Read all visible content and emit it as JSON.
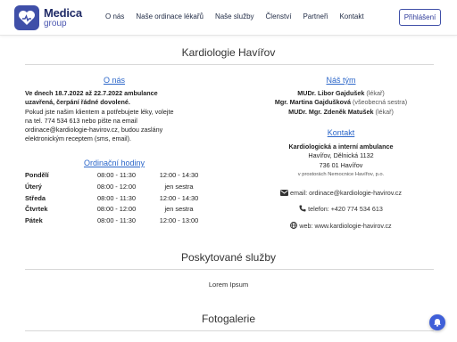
{
  "brand": {
    "name": "Medica",
    "sub": "group"
  },
  "nav": {
    "items": [
      {
        "label": "O nás"
      },
      {
        "label": "Naše ordinace lékařů"
      },
      {
        "label": "Naše služby"
      },
      {
        "label": "Členství"
      },
      {
        "label": "Partneři"
      },
      {
        "label": "Kontakt"
      }
    ],
    "login_label": "Přihlášení"
  },
  "page_title": "Kardiologie Havířov",
  "about": {
    "heading": "O nás",
    "notice_bold_1": "Ve dnech 18.7.2022 až 22.7.2022 ambulance",
    "notice_bold_2": "uzavřená, čerpání řádné dovolené.",
    "lines": [
      "Pokud jste našim klientem a potřebujete léky, volejte",
      "na tel. 774 534 613 nebo pište na email",
      "ordinace@kardiologie-havirov.cz, budou zaslány",
      "elektronickým receptem (sms, email)."
    ]
  },
  "hours": {
    "heading": "Ordinační hodiny",
    "rows": [
      {
        "day": "Pondělí",
        "a": "08:00 - 11:30",
        "b": "12:00 - 14:30"
      },
      {
        "day": "Úterý",
        "a": "08:00 - 12:00",
        "b": "jen sestra"
      },
      {
        "day": "Středa",
        "a": "08:00 - 11:30",
        "b": "12:00 - 14:30"
      },
      {
        "day": "Čtvrtek",
        "a": "08:00 - 12:00",
        "b": "jen sestra"
      },
      {
        "day": "Pátek",
        "a": "08:00 - 11:30",
        "b": "12:00 - 13:00"
      }
    ]
  },
  "team": {
    "heading": "Náš tým",
    "members": [
      {
        "name": "MUDr. Libor Gajdušek",
        "role": "(lékař)"
      },
      {
        "name": "Mgr. Martina Gajdušková",
        "role": "(všeobecná sestra)"
      },
      {
        "name": "MUDr. Mgr. Zdeněk Matušek",
        "role": "(lékař)"
      }
    ]
  },
  "contact": {
    "heading": "Kontakt",
    "org": "Kardiologická a interní ambulance",
    "street": "Havířov, Dělnická 1132",
    "city": "736 01 Havířov",
    "note": "v prostorách Nemocnice Havířov, p.o.",
    "email": "email: ordinace@kardiologie-havirov.cz",
    "phone": "telefon: +420 774 534 613",
    "web": "web: www.kardiologie-havirov.cz"
  },
  "services": {
    "heading": "Poskytované služby",
    "text": "Lorem Ipsum"
  },
  "gallery": {
    "heading": "Fotogalerie"
  },
  "colors": {
    "brand": "#3f4fa8",
    "link": "#2b66c9",
    "chat": "#3f5fd8"
  }
}
